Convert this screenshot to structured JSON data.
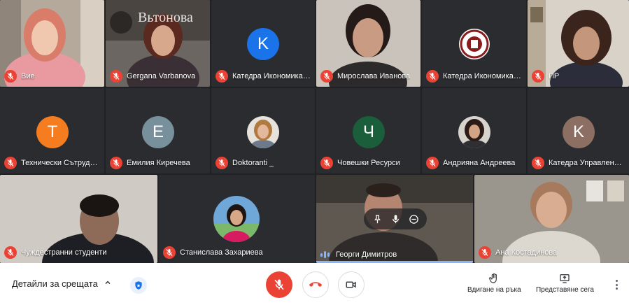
{
  "tiles": [
    {
      "name": "Вие",
      "muted": true
    },
    {
      "name": "Gergana Varbanova",
      "muted": true,
      "sign_text": "Вьтонова"
    },
    {
      "name": "Катедра Икономика и ...",
      "muted": true,
      "avatar_letter": "K",
      "avatar_color": "#1a73e8"
    },
    {
      "name": "Мирослава Иванова",
      "muted": true
    },
    {
      "name": "Катедра Икономика и ...",
      "muted": true
    },
    {
      "name": "ПР",
      "muted": true
    },
    {
      "name": "Технически Сътрудник",
      "muted": true,
      "avatar_letter": "T",
      "avatar_color": "#f57c1f"
    },
    {
      "name": "Емилия Киречева",
      "muted": true,
      "avatar_letter": "E",
      "avatar_color": "#78909c"
    },
    {
      "name": "Doktoranti _",
      "muted": true
    },
    {
      "name": "Човешки Ресурси",
      "muted": true,
      "avatar_letter": "Ч",
      "avatar_color": "#1b5e3b"
    },
    {
      "name": "Андрияна Андреева",
      "muted": true
    },
    {
      "name": "Катедра Управление и ...",
      "muted": true,
      "avatar_letter": "K",
      "avatar_color": "#8d6e63"
    },
    {
      "name": "Чуждестранни студенти",
      "muted": true
    },
    {
      "name": "Станислава Захариева",
      "muted": true
    },
    {
      "name": "Георги Димитров",
      "muted": false,
      "speaking": true
    },
    {
      "name": "Ана Костадинова",
      "muted": true
    }
  ],
  "bottom_bar": {
    "details_label": "Детайли за срещата",
    "raise_hand_label": "Вдигане на ръка",
    "present_label": "Представяне сега"
  },
  "icons": [
    "mic-off-icon",
    "chevron-up-icon",
    "shield-icon",
    "end-call-icon",
    "camera-icon",
    "hand-icon",
    "present-icon",
    "more-icon",
    "pin-icon",
    "mic-icon",
    "remove-icon"
  ],
  "colors": {
    "accent": "#1a73e8",
    "danger": "#ea4335",
    "speaking": "#8ab4f8"
  }
}
